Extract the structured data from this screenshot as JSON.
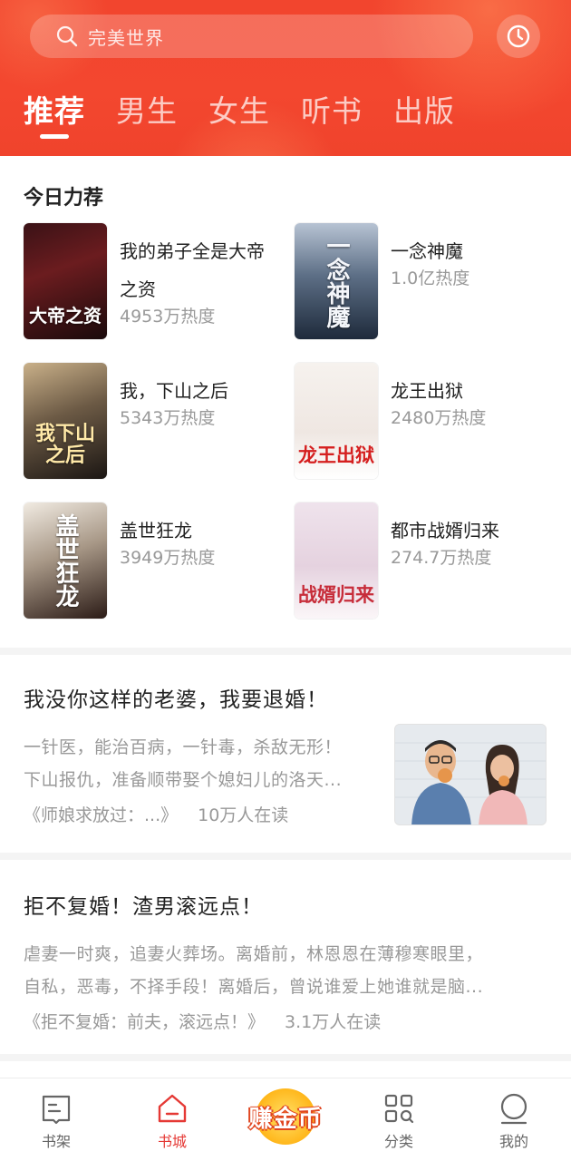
{
  "header": {
    "search_placeholder": "完美世界",
    "tabs": [
      {
        "label": "推荐",
        "active": true
      },
      {
        "label": "男生",
        "active": false
      },
      {
        "label": "女生",
        "active": false
      },
      {
        "label": "听书",
        "active": false
      },
      {
        "label": "出版",
        "active": false
      }
    ],
    "accent_color": "#f2452e"
  },
  "today": {
    "title": "今日力荐",
    "books": [
      {
        "name": "我的弟子全是大帝之资",
        "heat": "4953万热度",
        "cover_text": "大帝之资"
      },
      {
        "name": "一念神魔",
        "heat": "1.0亿热度",
        "cover_text": "一念神魔"
      },
      {
        "name": "我，下山之后",
        "heat": "5343万热度",
        "cover_text": "我下山之后"
      },
      {
        "name": "龙王出狱",
        "heat": "2480万热度",
        "cover_text": "龙王出狱"
      },
      {
        "name": "盖世狂龙",
        "heat": "3949万热度",
        "cover_text": "盖世狂龙"
      },
      {
        "name": "都市战婿归来",
        "heat": "274.7万热度",
        "cover_text": "战婿归来"
      }
    ]
  },
  "features": [
    {
      "title": "我没你这样的老婆，我要退婚！",
      "desc1": "一针医，能治百病，一针毒，杀敌无形！",
      "desc2": "下山报仇，准备顺带娶个媳妇儿的洛天...",
      "book": "《师娘求放过：...》",
      "reading": "10万人在读"
    },
    {
      "title": "拒不复婚！渣男滚远点！",
      "desc1": "虐妻一时爽，追妻火葬场。离婚前，林恩恩在薄穆寒眼里，",
      "desc2": "自私，恶毒，不择手段！离婚后，曾说谁爱上她谁就是脑...",
      "book": "《拒不复婚：前夫，滚远点！》",
      "reading": "3.1万人在读"
    }
  ],
  "bottom_nav": {
    "bookshelf": "书架",
    "bookstore": "书城",
    "earn": "赚金币",
    "category": "分类",
    "mine": "我的",
    "active_color": "#e53935"
  }
}
